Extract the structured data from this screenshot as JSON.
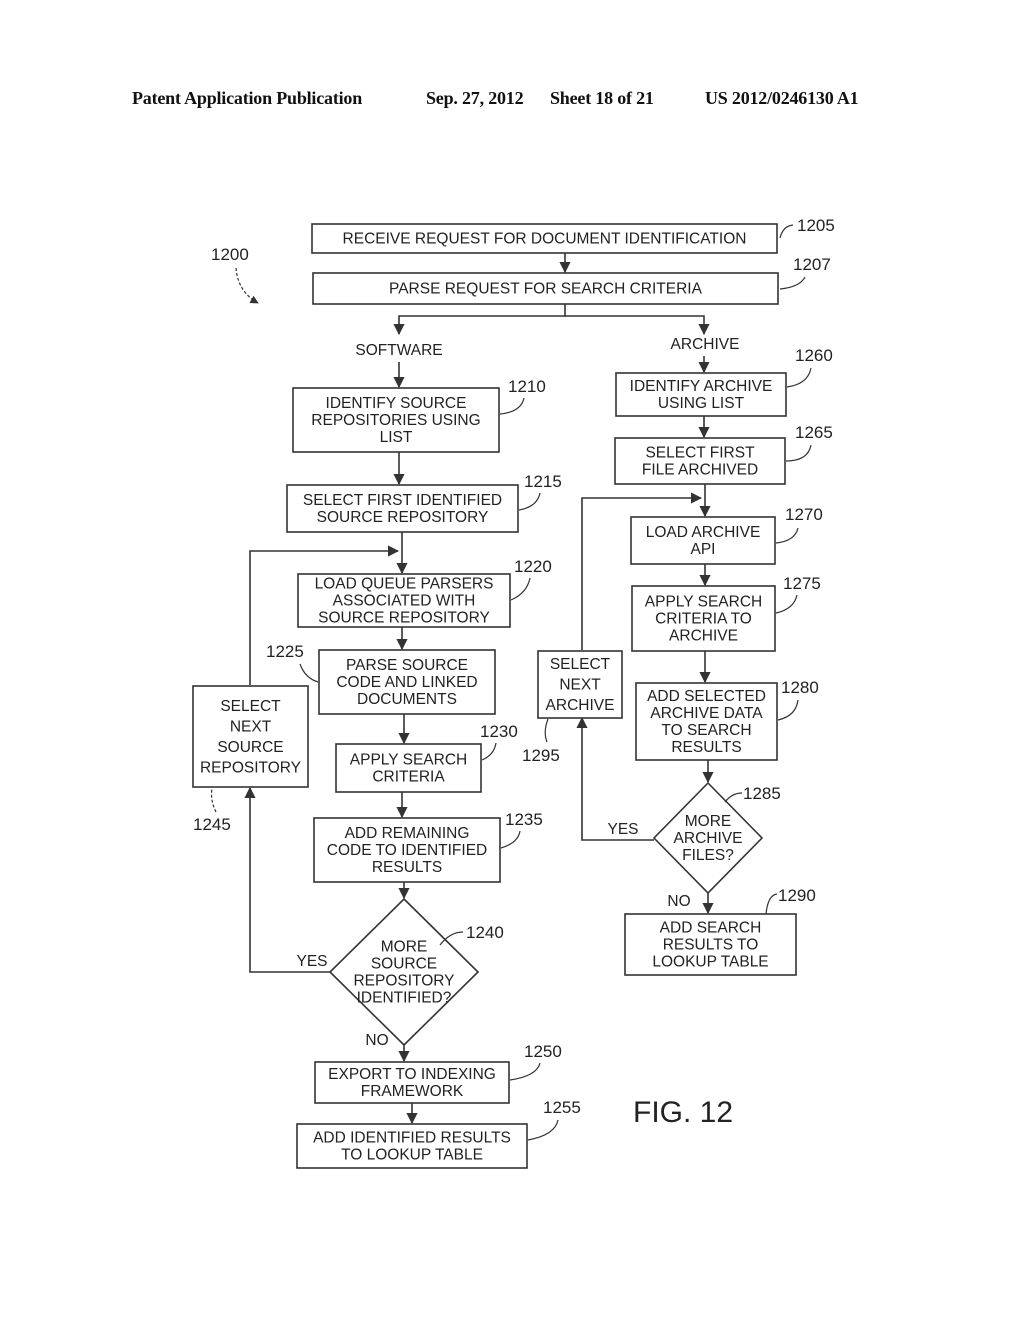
{
  "header": {
    "publication": "Patent Application Publication",
    "date": "Sep. 27, 2012",
    "sheet": "Sheet 18 of 21",
    "number": "US 2012/0246130 A1"
  },
  "figure": {
    "label": "FIG. 12",
    "ref": "1200"
  },
  "branches": {
    "software": "SOFTWARE",
    "archive": "ARCHIVE"
  },
  "nodes": {
    "n1205": {
      "ref": "1205",
      "lines": [
        "RECEIVE REQUEST FOR DOCUMENT IDENTIFICATION"
      ]
    },
    "n1207": {
      "ref": "1207",
      "lines": [
        "PARSE REQUEST FOR SEARCH CRITERIA"
      ]
    },
    "n1210": {
      "ref": "1210",
      "lines": [
        "IDENTIFY SOURCE",
        "REPOSITORIES USING",
        "LIST"
      ]
    },
    "n1215": {
      "ref": "1215",
      "lines": [
        "SELECT FIRST IDENTIFIED",
        "SOURCE REPOSITORY"
      ]
    },
    "n1220": {
      "ref": "1220",
      "lines": [
        "LOAD QUEUE PARSERS",
        "ASSOCIATED WITH",
        "SOURCE REPOSITORY"
      ]
    },
    "n1225": {
      "ref": "1225",
      "lines": [
        "PARSE SOURCE",
        "CODE AND LINKED",
        "DOCUMENTS"
      ]
    },
    "n1230": {
      "ref": "1230",
      "lines": [
        "APPLY SEARCH",
        "CRITERIA"
      ]
    },
    "n1235": {
      "ref": "1235",
      "lines": [
        "ADD REMAINING",
        "CODE TO IDENTIFIED",
        "RESULTS"
      ]
    },
    "n1240": {
      "ref": "1240",
      "lines": [
        "MORE",
        "SOURCE",
        "REPOSITORY",
        "IDENTIFIED?"
      ]
    },
    "n1245": {
      "ref": "1245",
      "lines": [
        "SELECT",
        "NEXT",
        "SOURCE",
        "REPOSITORY"
      ]
    },
    "n1250": {
      "ref": "1250",
      "lines": [
        "EXPORT TO INDEXING",
        "FRAMEWORK"
      ]
    },
    "n1255": {
      "ref": "1255",
      "lines": [
        "ADD IDENTIFIED RESULTS",
        "TO LOOKUP TABLE"
      ]
    },
    "n1260": {
      "ref": "1260",
      "lines": [
        "IDENTIFY ARCHIVE",
        "USING LIST"
      ]
    },
    "n1265": {
      "ref": "1265",
      "lines": [
        "SELECT FIRST",
        "FILE ARCHIVED"
      ]
    },
    "n1270": {
      "ref": "1270",
      "lines": [
        "LOAD ARCHIVE",
        "API"
      ]
    },
    "n1275": {
      "ref": "1275",
      "lines": [
        "APPLY SEARCH",
        "CRITERIA TO",
        "ARCHIVE"
      ]
    },
    "n1280": {
      "ref": "1280",
      "lines": [
        "ADD SELECTED",
        "ARCHIVE DATA",
        "TO SEARCH",
        "RESULTS"
      ]
    },
    "n1285": {
      "ref": "1285",
      "lines": [
        "MORE",
        "ARCHIVE",
        "FILES?"
      ]
    },
    "n1290": {
      "ref": "1290",
      "lines": [
        "ADD SEARCH",
        "RESULTS TO",
        "LOOKUP TABLE"
      ]
    },
    "n1295": {
      "ref": "1295",
      "lines": [
        "SELECT",
        "NEXT",
        "ARCHIVE"
      ]
    }
  },
  "edge_labels": {
    "yes_1240": "YES",
    "no_1240": "NO",
    "yes_1285": "YES",
    "no_1285": "NO"
  }
}
